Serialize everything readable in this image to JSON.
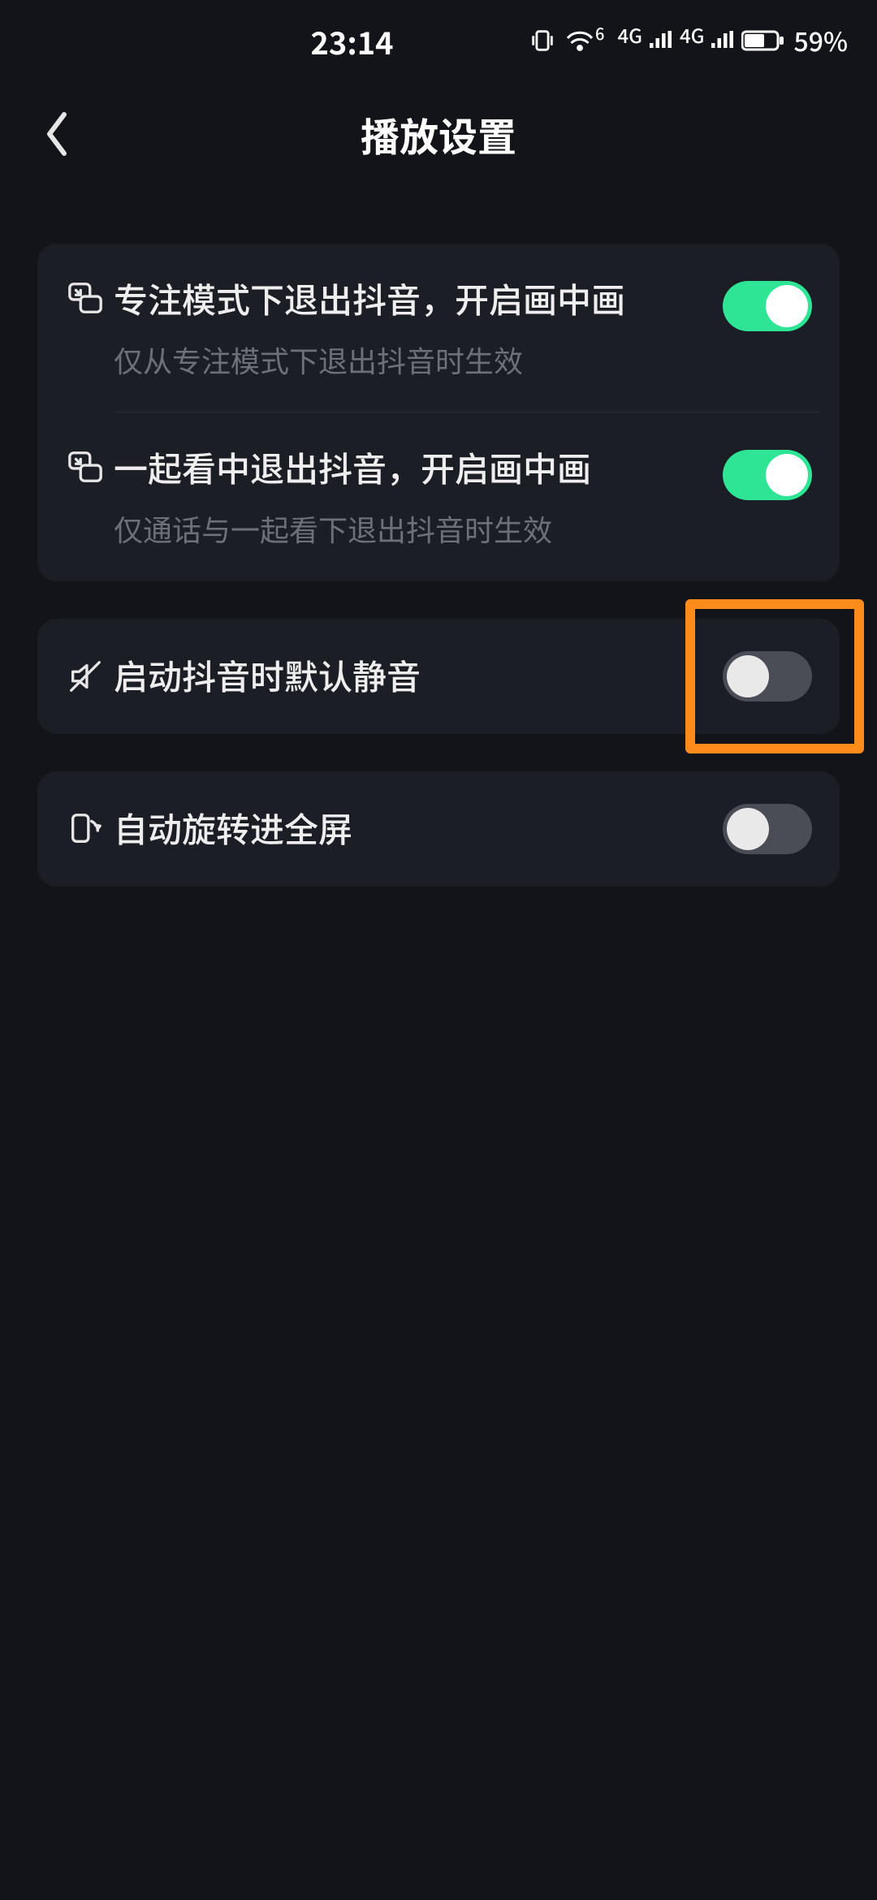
{
  "status": {
    "time": "23:14",
    "battery_pct": "59%",
    "net1_label": "4G",
    "net2_label": "4G",
    "wifi_label": "6"
  },
  "header": {
    "title": "播放设置"
  },
  "groups": [
    {
      "rows": [
        {
          "icon": "pip-icon",
          "title": "专注模式下退出抖音，开启画中画",
          "subtitle": "仅从专注模式下退出抖音时生效",
          "toggle": true
        },
        {
          "icon": "pip-icon",
          "title": "一起看中退出抖音，开启画中画",
          "subtitle": "仅通话与一起看下退出抖音时生效",
          "toggle": true
        }
      ]
    },
    {
      "rows": [
        {
          "icon": "mute-icon",
          "title": "启动抖音时默认静音",
          "toggle": false,
          "highlight": true
        }
      ]
    },
    {
      "rows": [
        {
          "icon": "rotate-icon",
          "title": "自动旋转进全屏",
          "toggle": false
        }
      ]
    }
  ],
  "colors": {
    "accent_on": "#2ee596",
    "highlight": "#ff8c1a"
  }
}
